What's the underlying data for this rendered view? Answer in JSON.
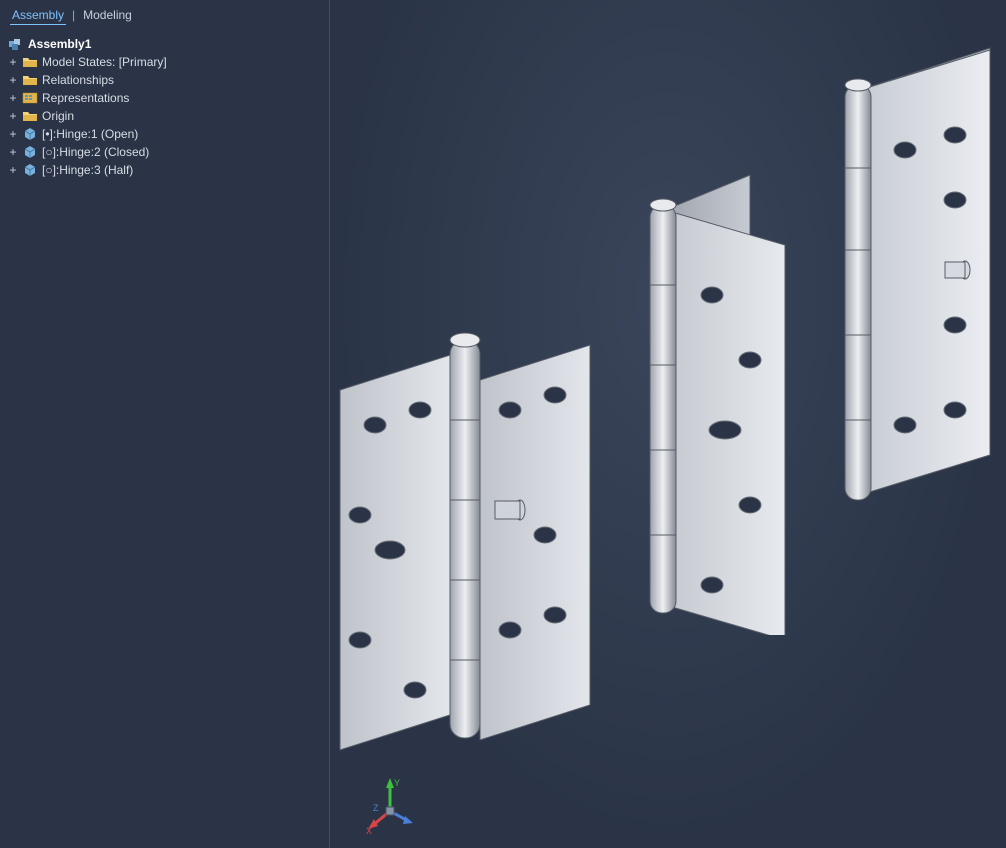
{
  "tabs": {
    "assembly": "Assembly",
    "modeling": "Modeling"
  },
  "tree": {
    "root": "Assembly1",
    "items": [
      {
        "icon": "folder",
        "label": "Model States: [Primary]"
      },
      {
        "icon": "folder",
        "label": "Relationships"
      },
      {
        "icon": "repr",
        "label": "Representations"
      },
      {
        "icon": "folder",
        "label": "Origin"
      },
      {
        "icon": "part",
        "label": "[•]:Hinge:1 (Open)"
      },
      {
        "icon": "part",
        "label": "[○]:Hinge:2 (Closed)"
      },
      {
        "icon": "part",
        "label": "[○]:Hinge:3 (Half)"
      }
    ]
  },
  "triad": {
    "x": "X",
    "y": "Y",
    "z": "Z"
  }
}
